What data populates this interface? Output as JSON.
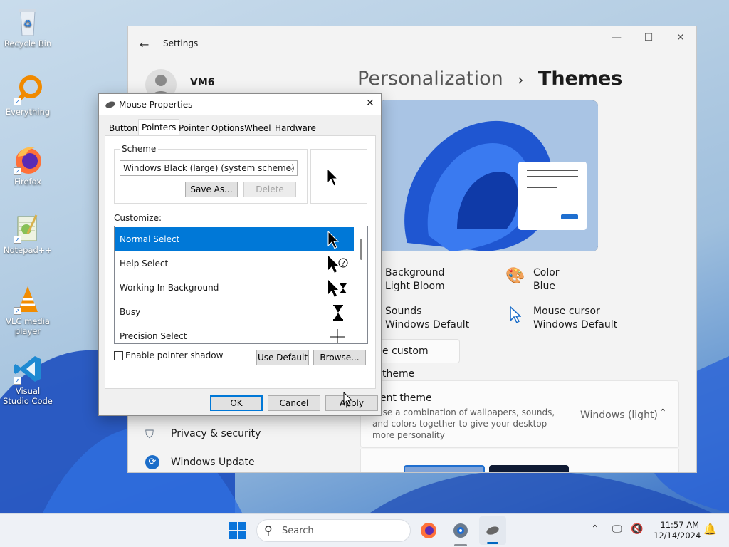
{
  "desktop": {
    "icons": [
      {
        "label": "Recycle Bin"
      },
      {
        "label": "Everything"
      },
      {
        "label": "Firefox"
      },
      {
        "label": "Notepad++"
      },
      {
        "label": "VLC media player"
      },
      {
        "label": "Visual Studio Code"
      }
    ]
  },
  "settings": {
    "title": "Settings",
    "user_name": "VM6",
    "breadcrumb_parent": "Personalization",
    "breadcrumb_sep": "›",
    "breadcrumb_current": "Themes",
    "theme_props": [
      {
        "title": "Background",
        "value": "Light Bloom"
      },
      {
        "title": "Color",
        "value": "Blue"
      },
      {
        "title": "Sounds",
        "value": "Windows Default"
      },
      {
        "title": "Mouse cursor",
        "value": "Windows Default"
      }
    ],
    "save_theme_label": "e custom theme",
    "current_theme": {
      "title": "rrent theme",
      "desc": "oose a combination of wallpapers, sounds, and colors together to give your desktop more personality",
      "value": "Windows (light)"
    },
    "nav": [
      {
        "label": "Privacy & security",
        "icon": "shield-icon"
      },
      {
        "label": "Windows Update",
        "icon": "update-icon"
      }
    ],
    "accent": "#0067c0"
  },
  "dialog": {
    "title": "Mouse Properties",
    "tabs": [
      "Buttons",
      "Pointers",
      "Pointer Options",
      "Wheel",
      "Hardware"
    ],
    "active_tab": "Pointers",
    "scheme_label": "Scheme",
    "scheme_value": "Windows Black (large) (system scheme)",
    "save_as": "Save As...",
    "delete": "Delete",
    "customize_label": "Customize:",
    "list": [
      {
        "label": "Normal Select",
        "icon": "arrow-cursor-icon"
      },
      {
        "label": "Help Select",
        "icon": "help-cursor-icon"
      },
      {
        "label": "Working In Background",
        "icon": "busy-arrow-cursor-icon"
      },
      {
        "label": "Busy",
        "icon": "hourglass-cursor-icon"
      },
      {
        "label": "Precision Select",
        "icon": "crosshair-cursor-icon"
      }
    ],
    "selected_index": 0,
    "shadow_label": "Enable pointer shadow",
    "use_default": "Use Default",
    "browse": "Browse...",
    "ok": "OK",
    "cancel": "Cancel",
    "apply": "Apply",
    "highlight": "#0078d7"
  },
  "taskbar": {
    "search_placeholder": "Search",
    "time": "11:57 AM",
    "date": "12/14/2024"
  }
}
